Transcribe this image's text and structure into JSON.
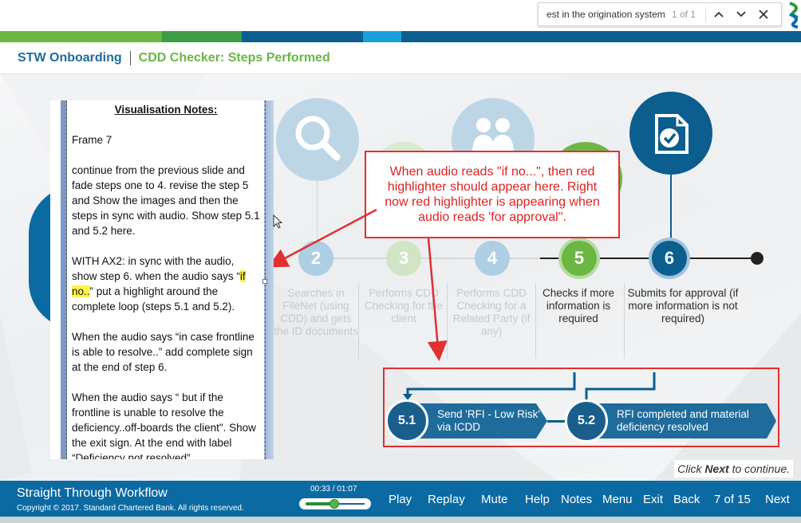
{
  "find_bar": {
    "query": "est in the origination system",
    "count": "1 of 1",
    "prev_icon": "chevron-up-icon",
    "next_icon": "chevron-down-icon",
    "close_icon": "close-icon"
  },
  "header": {
    "course": "STW Onboarding",
    "title": "CDD Checker: Steps Performed"
  },
  "stripe_colors": [
    "#6cb643",
    "#3e9b46",
    "#0b5e8e",
    "#1aa0dc",
    "#0b5e8e"
  ],
  "notes": {
    "title": "Visualisation Notes:",
    "frame": "Frame 7",
    "p1": "continue from the previous slide and fade steps one to 4. revise the step 5 and Show the images and then the steps in sync with audio.  Show step 5.1 and 5.2 here.",
    "p2_before": "WITH AX2:  in sync with the audio, show step 6. when the audio says “",
    "p2_highlight": "if no..",
    "p2_after": "” put a highlight around the complete loop (steps 5.1 and 5.2).",
    "p3": "When the audio says  “in case frontline is able to resolve..” add complete sign at the end of step 6.",
    "p4": "When the audio says “ but if the frontline is unable to resolve the deficiency..off-boards the client\". Show the exit sign. At the end with label “Deficiency not resolved”"
  },
  "steps": [
    {
      "num": "2",
      "label": "Searches in FileNet (using CDD) and gets the ID documents",
      "state": "faded"
    },
    {
      "num": "3",
      "label": "Performs CDD Checking for the client",
      "state": "faded"
    },
    {
      "num": "4",
      "label": "Performs CDD Checking for a Related Party (if any)",
      "state": "faded"
    },
    {
      "num": "5",
      "label": "Checks if more information is required",
      "state": "active"
    },
    {
      "num": "6",
      "label": "Submits for approval (if more information is not required)",
      "state": "active"
    }
  ],
  "callout": "When audio reads \"if no...\", then red highlighter should appear here. Right now red highlighter is appearing when audio reads 'for approval\".",
  "substeps": [
    {
      "num": "5.1",
      "label": "Send 'RFI - Low Risk' via ICDD"
    },
    {
      "num": "5.2",
      "label": "RFI completed and material deficiency resolved"
    }
  ],
  "click_next": {
    "prefix": "Click ",
    "bold": "Next",
    "suffix": " to continue."
  },
  "footer": {
    "title": "Straight Through Workflow",
    "copyright": "Copyright © 2017. Standard Chartered Bank. All rights reserved.",
    "time": "00:33 / 01:07",
    "progress": 0.49,
    "nav": {
      "play": "Play",
      "replay": "Replay",
      "mute": "Mute",
      "help": "Help",
      "notes": "Notes",
      "menu": "Menu",
      "exit": "Exit",
      "back": "Back",
      "next": "Next"
    },
    "page": "7 of 15"
  },
  "colors": {
    "primary_blue": "#0b6aa2",
    "green": "#6cb643",
    "red_annotation": "#e03030",
    "step_dark": "#0b5e8e"
  }
}
